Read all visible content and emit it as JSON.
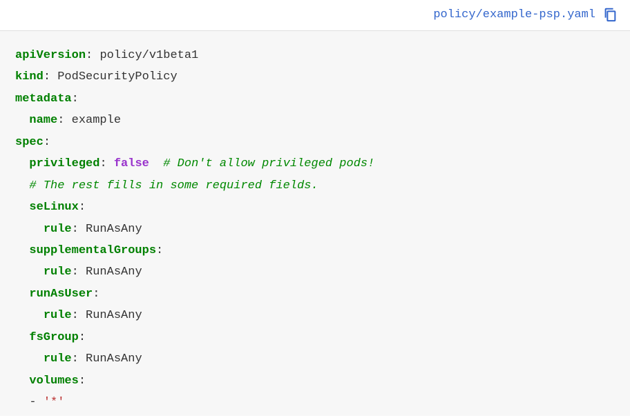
{
  "file_path": "policy/example-psp.yaml",
  "yaml": {
    "apiVersion_key": "apiVersion",
    "apiVersion_val": "policy/v1beta1",
    "kind_key": "kind",
    "kind_val": "PodSecurityPolicy",
    "metadata_key": "metadata",
    "name_key": "name",
    "name_val": "example",
    "spec_key": "spec",
    "privileged_key": "privileged",
    "privileged_val": "false",
    "privileged_comment": "# Don't allow privileged pods!",
    "rest_comment": "# The rest fills in some required fields.",
    "seLinux_key": "seLinux",
    "rule_key": "rule",
    "runAsAny": "RunAsAny",
    "supplementalGroups_key": "supplementalGroups",
    "runAsUser_key": "runAsUser",
    "fsGroup_key": "fsGroup",
    "volumes_key": "volumes",
    "volumes_item": "'*'"
  }
}
